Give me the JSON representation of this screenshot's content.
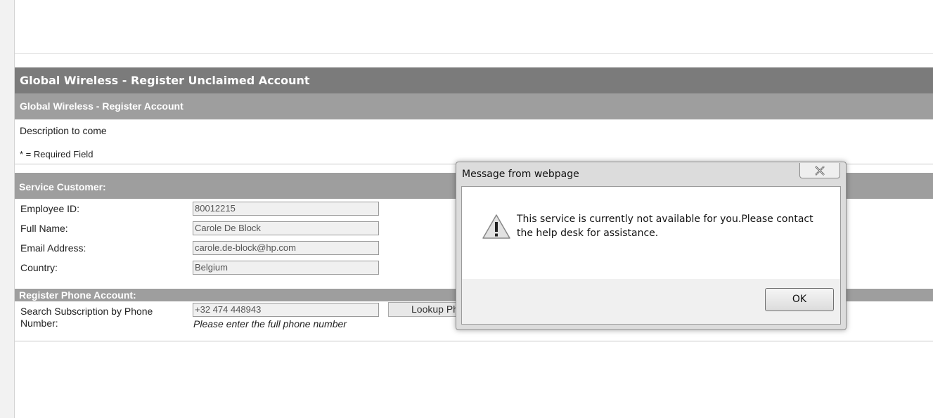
{
  "page": {
    "main_header": "Global Wireless - Register Unclaimed Account",
    "sub_header": "Global Wireless - Register Account",
    "description": "Description to come",
    "required_note": "* = Required Field"
  },
  "service_customer": {
    "header": "Service Customer:",
    "fields": [
      {
        "label": "Employee ID:",
        "value": "80012215"
      },
      {
        "label": "Full Name:",
        "value": "Carole De Block"
      },
      {
        "label": "Email Address:",
        "value": "carole.de-block@hp.com"
      },
      {
        "label": "Country:",
        "value": "Belgium"
      }
    ]
  },
  "register_phone": {
    "header": "Register Phone Account:",
    "search_label": "Search Subscription by Phone Number:",
    "phone_value": "+32 474 448943",
    "lookup_button": "Lookup Ph",
    "hint": "Please enter the full phone number"
  },
  "dialog": {
    "title": "Message from webpage",
    "message": "This service is currently not available for you.Please contact the help desk for assistance.",
    "ok_label": "OK",
    "icon": "warning-icon",
    "close_icon": "close-icon"
  }
}
